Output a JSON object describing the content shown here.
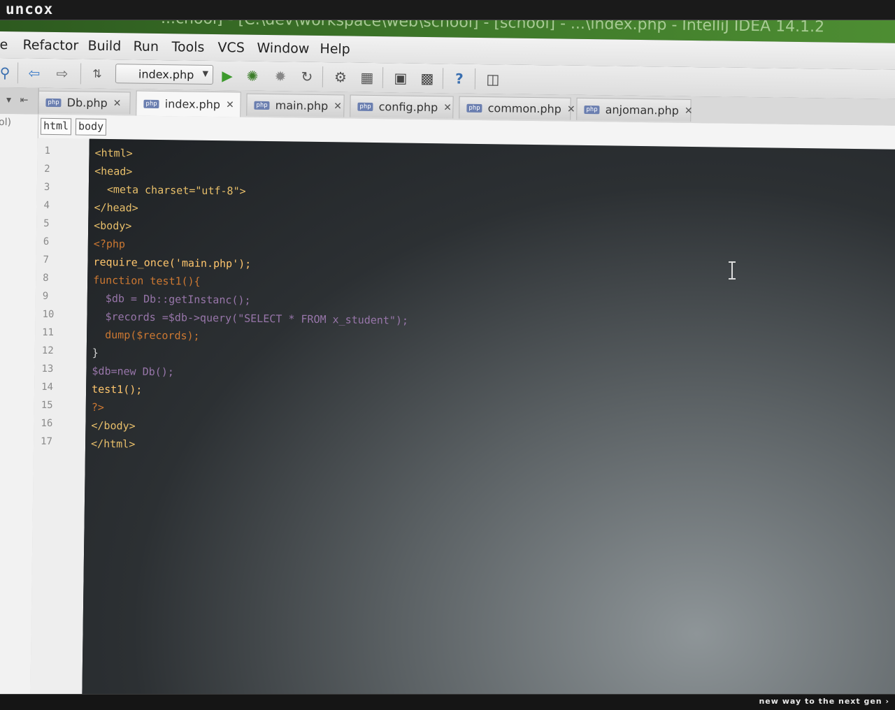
{
  "overlay": {
    "brand": "uncox",
    "tagline": "new way to the next gen ›"
  },
  "window": {
    "title": "...chool] - [C:\\dev\\workspace\\web\\school] - [school] - ...\\index.php - IntelliJ IDEA 14.1.2"
  },
  "menu": [
    "e",
    "Refactor",
    "Build",
    "Run",
    "Tools",
    "VCS",
    "Window",
    "Help"
  ],
  "toolbar": {
    "run_config": "index.php",
    "icons": [
      "search-icon",
      "back-arrow-icon",
      "forward-arrow-icon",
      "sort-icon",
      "run-icon",
      "debug-icon",
      "coverage-icon",
      "reload-icon",
      "settings-icon",
      "structure-icon",
      "android-sdk-icon",
      "android-icon",
      "help-icon",
      "plugin-icon"
    ]
  },
  "tabs": [
    {
      "label": "Db.php",
      "active": false
    },
    {
      "label": "index.php",
      "active": true
    },
    {
      "label": "main.php",
      "active": false
    },
    {
      "label": "config.php",
      "active": false
    },
    {
      "label": "common.php",
      "active": false
    },
    {
      "label": "anjoman.php",
      "active": false
    }
  ],
  "tab_badge": "php",
  "breadcrumbs": [
    "html",
    "body"
  ],
  "project_panel": {
    "label": "ol)"
  },
  "editor": {
    "line_numbers": [
      "1",
      "2",
      "3",
      "4",
      "5",
      "6",
      "7",
      "8",
      "9",
      "10",
      "11",
      "12",
      "13",
      "14",
      "15",
      "16",
      "17"
    ],
    "lines": [
      "<html>",
      "<head>",
      "  <meta charset=\"utf-8\">",
      "</head>",
      "<body>",
      "<?php",
      "require_once('main.php');",
      "function test1(){",
      "  $db = Db::getInstanc();",
      "  $records =$db->query(\"SELECT * FROM x_student\");",
      "  dump($records);",
      "}",
      "$db=new Db();",
      "test1();",
      "?>",
      "</body>",
      "</html>"
    ]
  },
  "colors": {
    "titlebar": "#3f7a2a",
    "editor_bg": "#2c3033",
    "tag": "#e8bf6a",
    "string": "#a5c25c",
    "keyword": "#cc7832"
  }
}
